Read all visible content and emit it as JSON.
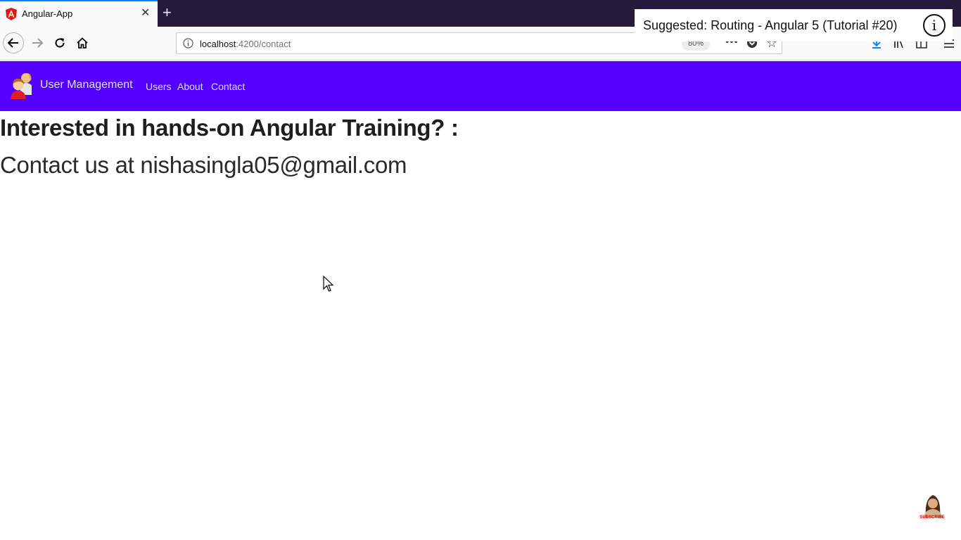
{
  "browser": {
    "tab": {
      "title": "Angular-App",
      "close_glyph": "✕",
      "new_tab_glyph": "+"
    },
    "url": {
      "host": "localhost",
      "path": ":4200/contact"
    },
    "zoom": "80%",
    "page_actions_glyph": "•••",
    "star_glyph": "☆",
    "icons": [
      "back-arrow-icon",
      "forward-arrow-icon",
      "reload-icon",
      "home-icon",
      "info-icon",
      "pocket-icon",
      "star-icon",
      "download-icon",
      "library-icon",
      "sidebar-icon",
      "menu-icon"
    ]
  },
  "suggestion": {
    "text": "Suggested: Routing - Angular 5 (Tutorial #20)",
    "info_glyph": "i"
  },
  "app": {
    "brand": "User Management",
    "nav": [
      "Users",
      "About",
      "Contact"
    ],
    "header_color": "#5500ff"
  },
  "content": {
    "heading": "Interested in hands-on Angular Training? :",
    "contact": "Contact us at nishasingla05@gmail.com"
  },
  "overlay": {
    "subscribe_label": "SUBSCRIBE"
  }
}
